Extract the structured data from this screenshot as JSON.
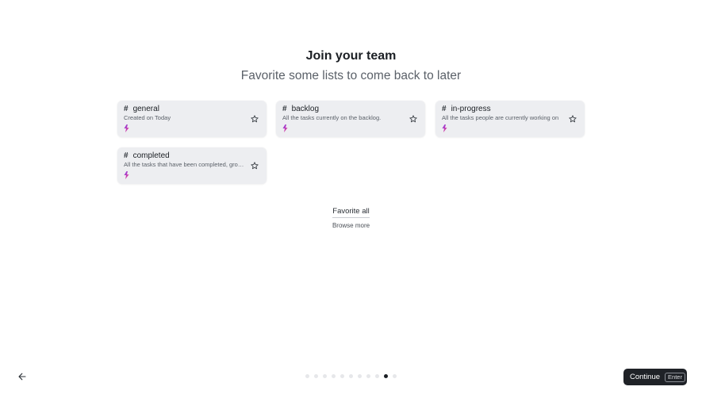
{
  "header": {
    "title": "Join your team",
    "subtitle": "Favorite some lists to come back to later"
  },
  "lists": [
    {
      "name": "general",
      "description": "Created on Today"
    },
    {
      "name": "backlog",
      "description": "All the tasks currently on the backlog."
    },
    {
      "name": "in-progress",
      "description": "All the tasks people are currently working on"
    },
    {
      "name": "completed",
      "description": "All the tasks that have been completed, grouped by"
    }
  ],
  "actions": {
    "favorite_all": "Favorite all",
    "browse_more": "Browse more"
  },
  "footer": {
    "continue_label": "Continue",
    "continue_shortcut": "Enter",
    "steps_total": 11,
    "steps_current": 10
  },
  "icons": {
    "hash": "#",
    "star": "star-outline-icon",
    "bolt": "bolt-icon",
    "back": "arrow-left-icon"
  },
  "colors": {
    "card_bg": "#edeef1",
    "button_bg": "#1f2227",
    "bolt_gradient": [
      "#7b3ff2",
      "#ff3d7f"
    ]
  }
}
